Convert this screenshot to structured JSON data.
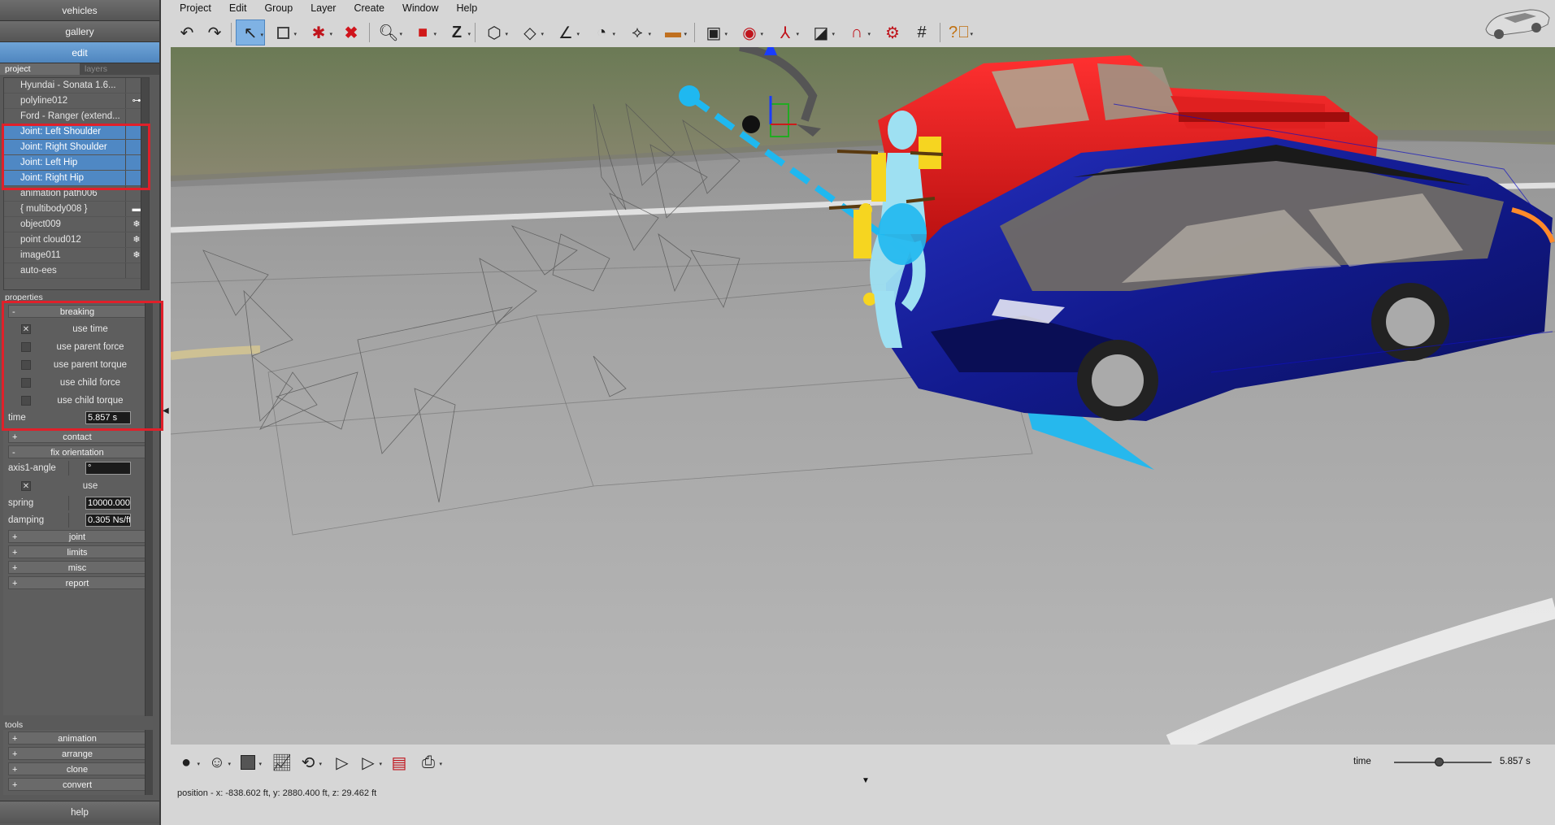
{
  "left_nav": {
    "vehicles": "vehicles",
    "gallery": "gallery",
    "edit": "edit"
  },
  "tabs": {
    "project": "project",
    "layers": "layers"
  },
  "project_items": [
    {
      "label": "Hyundai - Sonata 1.6...",
      "icon": ""
    },
    {
      "label": "polyline012",
      "icon": "link-icon"
    },
    {
      "label": "Ford - Ranger (extend...",
      "icon": ""
    },
    {
      "label": "Joint: Left Shoulder",
      "icon": ""
    },
    {
      "label": "Joint: Right Shoulder",
      "icon": ""
    },
    {
      "label": "Joint: Left Hip",
      "icon": ""
    },
    {
      "label": "Joint: Right Hip",
      "icon": ""
    },
    {
      "label": "animation path006",
      "icon": ""
    },
    {
      "label": "{ multibody008 }",
      "icon": "folder-icon"
    },
    {
      "label": "object009",
      "icon": "snowflake-icon"
    },
    {
      "label": "point cloud012",
      "icon": "snowflake-icon"
    },
    {
      "label": "image011",
      "icon": "snowflake-icon"
    },
    {
      "label": "auto-ees",
      "icon": ""
    }
  ],
  "sections": {
    "properties": "properties",
    "tools": "tools"
  },
  "breaking": {
    "title": "breaking",
    "use_time": "use time",
    "use_parent_force": "use parent force",
    "use_parent_torque": "use parent torque",
    "use_child_force": "use child force",
    "use_child_torque": "use child torque",
    "time_label": "time",
    "time_value": "5.857 s"
  },
  "contact": {
    "title": "contact"
  },
  "fix_orientation": {
    "title": "fix orientation",
    "axis1_label": "axis1-angle",
    "axis1_value": "°",
    "use": "use",
    "spring_label": "spring",
    "spring_value": "10000.000",
    "damping_label": "damping",
    "damping_value": "0.305 Ns/ft"
  },
  "groups": {
    "joint": "joint",
    "limits": "limits",
    "misc": "misc",
    "report": "report"
  },
  "tools": [
    "animation",
    "arrange",
    "clone",
    "convert"
  ],
  "help": "help",
  "menu": [
    "Project",
    "Edit",
    "Group",
    "Layer",
    "Create",
    "Window",
    "Help"
  ],
  "time": {
    "label": "time",
    "value": "5.857 s",
    "fraction": 0.46
  },
  "status": "position - x: -838.602 ft, y: 2880.400 ft, z: 29.462 ft",
  "colors": {
    "selection": "#4f88c4",
    "highlight_box": "#e0202a",
    "arrow": "#1fb8f0",
    "red_truck": "#d81818",
    "blue_car": "#10148c"
  }
}
